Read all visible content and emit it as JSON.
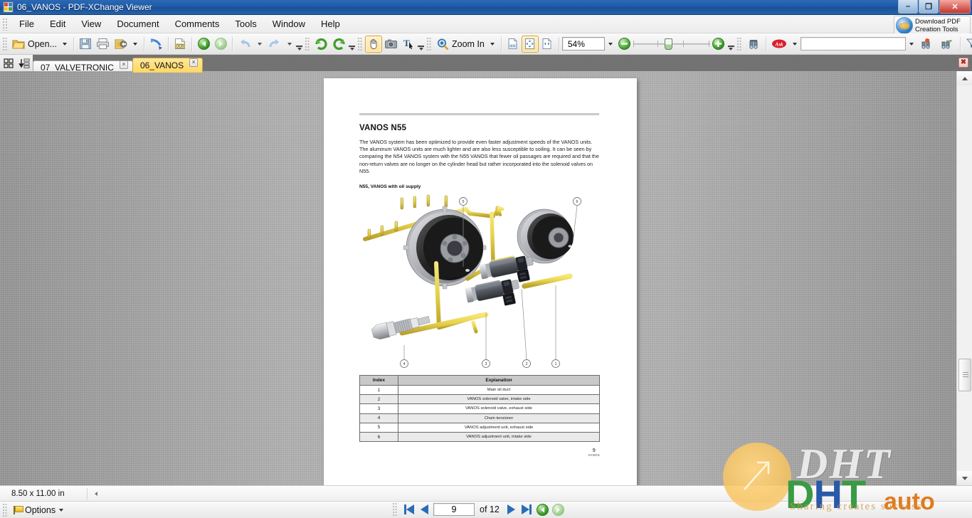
{
  "window": {
    "title": "06_VANOS - PDF-XChange Viewer",
    "app_icon": "pdf-document-icon",
    "buttons": {
      "minimize": "–",
      "maximize": "❐",
      "close": "✕"
    }
  },
  "menu": {
    "items": [
      "File",
      "Edit",
      "View",
      "Document",
      "Comments",
      "Tools",
      "Window",
      "Help"
    ]
  },
  "download_button": {
    "line1": "Download PDF",
    "line2": "Creation Tools",
    "icon": "globe-icon"
  },
  "toolbar": {
    "open_label": "Open...",
    "zoom_tool_label": "Zoom In",
    "zoom_value": "54%",
    "find_value": "",
    "items": [
      {
        "name": "open-file-button",
        "icon": "open-folder-icon"
      },
      {
        "name": "save-button",
        "icon": "floppy-disk-icon"
      },
      {
        "name": "print-button",
        "icon": "printer-icon"
      },
      {
        "name": "export-button",
        "icon": "export-image-icon"
      },
      {
        "name": "email-button",
        "icon": "send-mail-icon"
      },
      {
        "name": "ocr-button",
        "icon": "ocr-icon"
      },
      {
        "name": "back-button",
        "icon": "green-back-arrow-icon"
      },
      {
        "name": "forward-button",
        "icon": "green-forward-arrow-icon"
      },
      {
        "name": "undo-button",
        "icon": "undo-arrow-icon"
      },
      {
        "name": "redo-button",
        "icon": "redo-arrow-icon"
      },
      {
        "name": "rotate-left-button",
        "icon": "rotate-ccw-icon"
      },
      {
        "name": "rotate-right-button",
        "icon": "rotate-cw-icon"
      },
      {
        "name": "hand-tool-button",
        "icon": "hand-icon"
      },
      {
        "name": "snapshot-tool-button",
        "icon": "camera-icon"
      },
      {
        "name": "select-text-tool-button",
        "icon": "text-select-icon"
      },
      {
        "name": "zoom-in-tool-button",
        "icon": "magnifier-plus-icon"
      },
      {
        "name": "actual-size-button",
        "icon": "one-to-one-page-icon"
      },
      {
        "name": "fit-page-button",
        "icon": "fit-page-icon"
      },
      {
        "name": "fit-width-button",
        "icon": "fit-width-icon"
      },
      {
        "name": "zoom-out-button",
        "icon": "green-minus-circle-icon"
      },
      {
        "name": "zoom-in-button",
        "icon": "green-plus-circle-icon"
      },
      {
        "name": "search-button",
        "icon": "binoculars-icon"
      },
      {
        "name": "ask-search-button",
        "icon": "ask-logo-icon"
      },
      {
        "name": "search-web-button",
        "icon": "search-web-icon"
      },
      {
        "name": "search-forward-button",
        "icon": "search-forward-icon"
      },
      {
        "name": "filter-button",
        "icon": "funnel-check-icon"
      }
    ]
  },
  "tabs": {
    "tools": [
      {
        "name": "thumbnail-grid-button",
        "icon": "grid-icon"
      },
      {
        "name": "sort-tabs-button",
        "icon": "sort-down-icon"
      }
    ],
    "items": [
      {
        "label": "07_VALVETRONIC",
        "active": false
      },
      {
        "label": "06_VANOS",
        "active": true
      }
    ],
    "close_label": "×",
    "close_all_label": "✖"
  },
  "document": {
    "rule": "",
    "heading": "VANOS N55",
    "paragraph": "The VANOS system has been optimized to provide even faster adjustment speeds of the VANOS units. The aluminum VANOS units are much lighter and are also less susceptible to soiling. It can be seen by comparing the N54 VANOS system with the N55 VANOS that fewer oil passages are required and that the non-return valves are no longer on the cylinder head but rather incorporated into the solenoid valves on N55.",
    "figure_caption": "N55, VANOS with oil supply",
    "figure_callouts": [
      "1",
      "2",
      "3",
      "4",
      "5",
      "6"
    ],
    "table": {
      "headers": [
        "Index",
        "Explanation"
      ],
      "rows": [
        [
          "1",
          "Main oil duct"
        ],
        [
          "2",
          "VANOS solenoid valve, intake side"
        ],
        [
          "3",
          "VANOS solenoid valve, exhaust side"
        ],
        [
          "4",
          "Chain tensioner"
        ],
        [
          "5",
          "VANOS adjustment unit, exhaust side"
        ],
        [
          "6",
          "VANOS adjustment unit, intake side"
        ]
      ]
    },
    "page_number": "9",
    "page_section": "VANOS"
  },
  "status": {
    "page_size": "8.50 x 11.00 in",
    "options_label": "Options",
    "current_page": "9",
    "of_label": "of 12"
  },
  "watermark": {
    "grey_text": "DHT",
    "green_d": "D",
    "blue_h": "H",
    "green_t": "T",
    "auto_text": "auto",
    "slogan": "Sharing creates success"
  },
  "colors": {
    "titlebar": "#1f5aa8",
    "tab_active": "#ffd761",
    "accent_green": "#3f9d2b",
    "doc_bg": "#9e9e9e",
    "watermark_green": "#3a9a45",
    "watermark_blue": "#2a59a8",
    "watermark_orange": "#e07b1f"
  }
}
